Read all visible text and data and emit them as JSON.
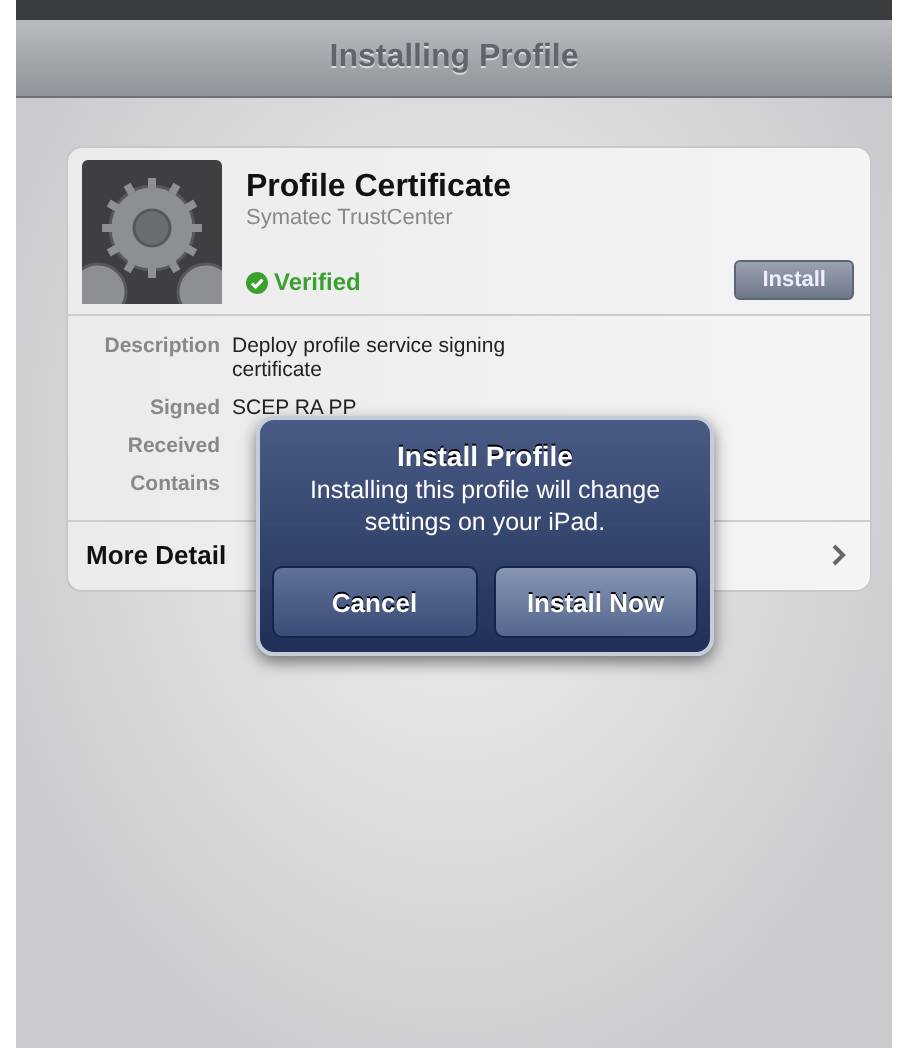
{
  "nav_bar": {
    "title": "Installing Profile"
  },
  "profile": {
    "name": "Profile Certificate",
    "issuer": "Symatec TrustCenter",
    "verified": true,
    "verified_label": "Verified",
    "install_button": "Install"
  },
  "details": [
    {
      "label": "Description",
      "value": "Deploy profile service signing certificate"
    },
    {
      "label": "Signed",
      "value": "SCEP RA PP"
    },
    {
      "label": "Received"
    },
    {
      "label": "Contains"
    }
  ],
  "more_details": {
    "label": "More Detail"
  },
  "alert": {
    "title": "Install Profile",
    "message": "Installing this profile will change settings on your iPad.",
    "buttons": [
      {
        "label": "Cancel",
        "kind": "cancel"
      },
      {
        "label": "Install Now",
        "kind": "default"
      }
    ]
  }
}
